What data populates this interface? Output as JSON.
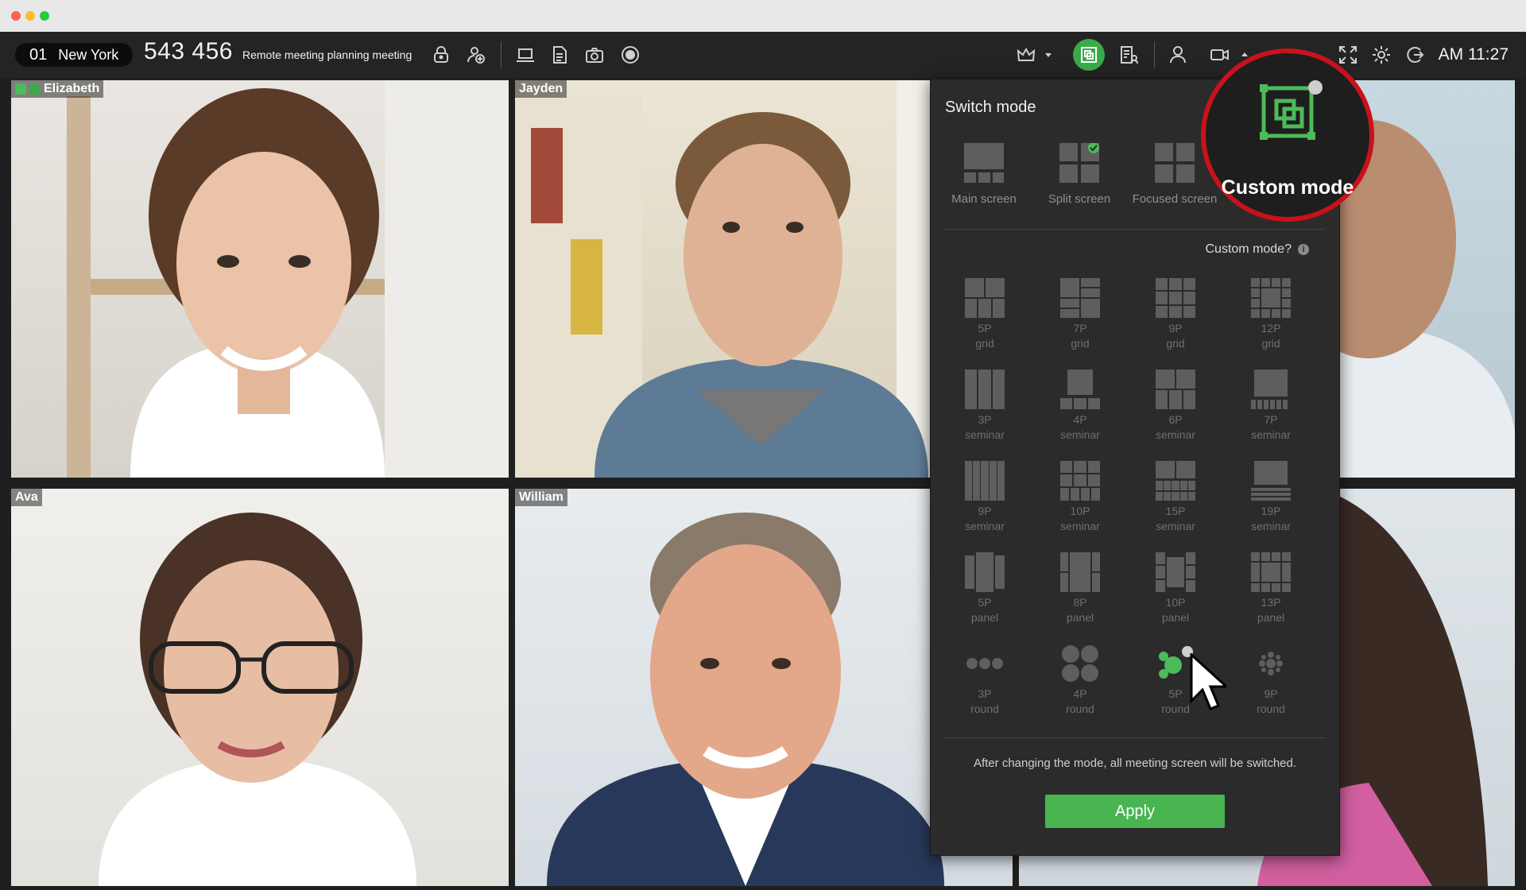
{
  "window": {
    "traffic_lights": [
      "#ff5f57",
      "#febc2e",
      "#28c840"
    ]
  },
  "toolbar": {
    "room_number": "01",
    "room_name": "New York",
    "meeting_id": "543 456",
    "meeting_title": "Remote meeting planning meeting",
    "time": "AM 11:27",
    "left_icons": [
      "lock-icon",
      "add-person-icon",
      "screen-share-icon",
      "document-icon",
      "camera-icon",
      "record-icon"
    ],
    "right_icons": [
      "crown-icon",
      "dropdown-icon",
      "layout-mode-icon",
      "attendee-list-icon",
      "participant-icon",
      "video-icon",
      "fullscreen-icon",
      "settings-icon",
      "exit-icon"
    ]
  },
  "participants": [
    {
      "name": "Elizabeth",
      "host": true
    },
    {
      "name": "Jayden"
    },
    {
      "name": "Ava"
    },
    {
      "name": "William"
    }
  ],
  "panel": {
    "title": "Switch mode",
    "modes": [
      {
        "label": "Main screen"
      },
      {
        "label": "Split screen",
        "selected": true
      },
      {
        "label": "Focused screen"
      }
    ],
    "custom_mode_question": "Custom mode?",
    "info_glyph": "i",
    "layouts": [
      {
        "line1": "5P",
        "line2": "grid"
      },
      {
        "line1": "7P",
        "line2": "grid"
      },
      {
        "line1": "9P",
        "line2": "grid"
      },
      {
        "line1": "12P",
        "line2": "grid"
      },
      {
        "line1": "3P",
        "line2": "seminar"
      },
      {
        "line1": "4P",
        "line2": "seminar"
      },
      {
        "line1": "6P",
        "line2": "seminar"
      },
      {
        "line1": "7P",
        "line2": "seminar"
      },
      {
        "line1": "9P",
        "line2": "seminar"
      },
      {
        "line1": "10P",
        "line2": "seminar"
      },
      {
        "line1": "15P",
        "line2": "seminar"
      },
      {
        "line1": "19P",
        "line2": "seminar"
      },
      {
        "line1": "5P",
        "line2": "panel"
      },
      {
        "line1": "8P",
        "line2": "panel"
      },
      {
        "line1": "10P",
        "line2": "panel"
      },
      {
        "line1": "13P",
        "line2": "panel"
      },
      {
        "line1": "3P",
        "line2": "round"
      },
      {
        "line1": "4P",
        "line2": "round"
      },
      {
        "line1": "5P",
        "line2": "round",
        "hovered": true
      },
      {
        "line1": "9P",
        "line2": "round"
      }
    ],
    "note": "After changing the mode, all meeting screen will be switched.",
    "apply_label": "Apply"
  },
  "callout": {
    "label": "Custom mode",
    "accent": "#c8121b",
    "green": "#4cbb5a"
  }
}
